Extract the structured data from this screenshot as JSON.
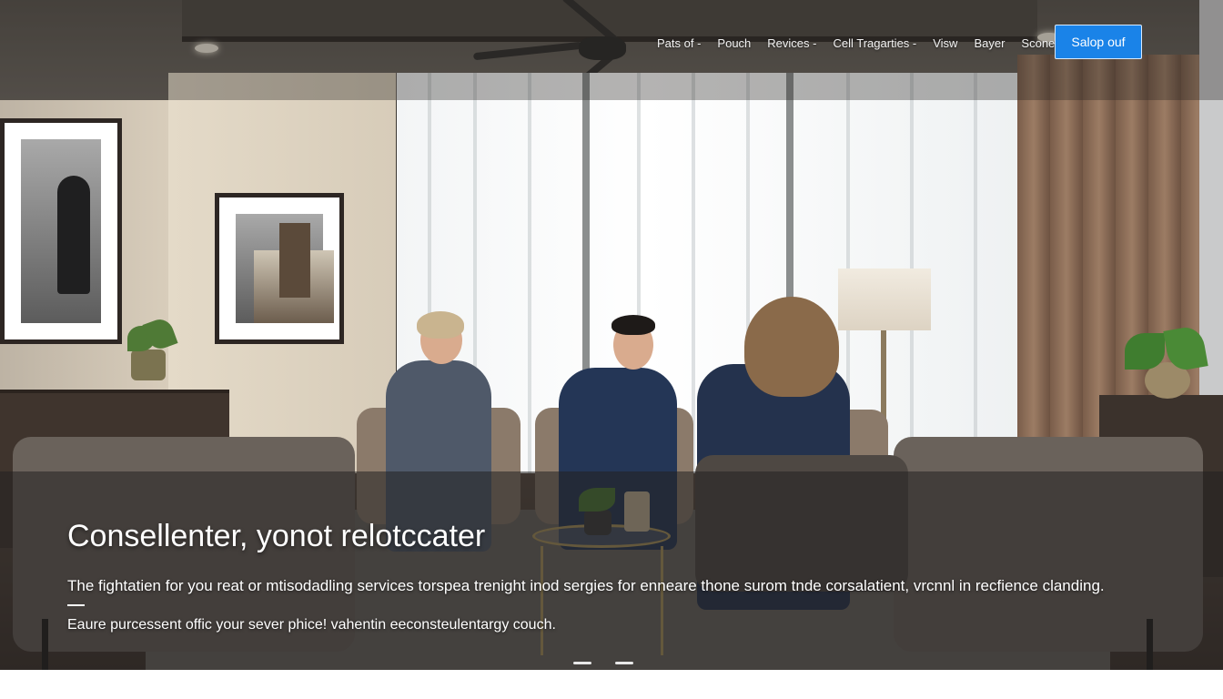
{
  "nav": {
    "items": [
      {
        "label": "Pats of -",
        "icon": ""
      },
      {
        "label": "Pouch",
        "icon": ""
      },
      {
        "label": "Revices -",
        "icon": ""
      },
      {
        "label": "Cell Tragarties -",
        "icon": ""
      },
      {
        "label": "Visw",
        "icon": ""
      },
      {
        "label": "Bayer",
        "icon": ""
      },
      {
        "label": "Scone",
        "icon": ""
      }
    ],
    "cta_label": "Salop ouf"
  },
  "hero": {
    "title": "Consellenter, yonot relotccater",
    "description": "The fightatien for you reat or mtisodadling services torspea trenight inod sergies for enneare thone surom tnde corsalatient, vrcnnl in recfience clanding.",
    "subtext": "Eaure purcessent offic your sever phice! vahentin eeconsteulentargy couch."
  },
  "colors": {
    "cta_background": "#1a83e8",
    "overlay": "#232120"
  },
  "carousel": {
    "slides": 2
  }
}
